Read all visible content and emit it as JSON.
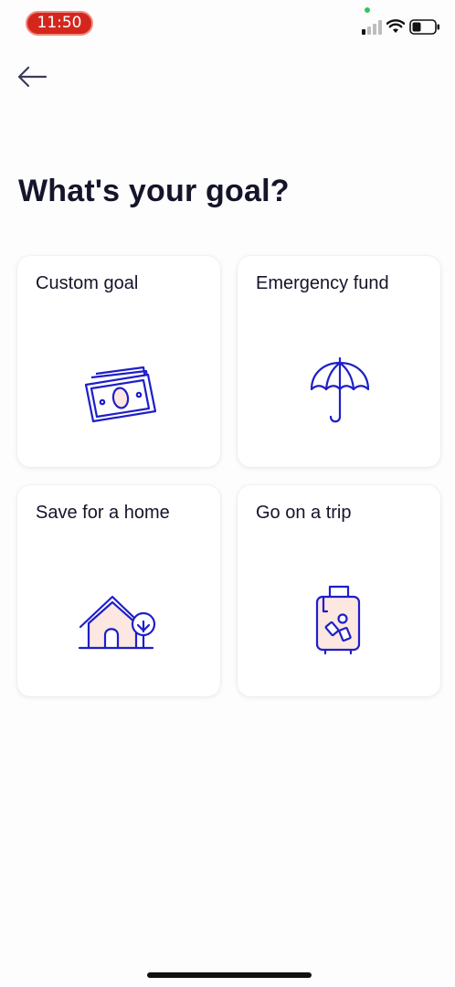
{
  "status_bar": {
    "time": "11:50"
  },
  "header": {
    "title": "What's your goal?"
  },
  "goals": [
    {
      "label": "Custom goal",
      "icon": "money-icon"
    },
    {
      "label": "Emergency fund",
      "icon": "umbrella-icon"
    },
    {
      "label": "Save for a home",
      "icon": "house-icon"
    },
    {
      "label": "Go on a trip",
      "icon": "suitcase-icon"
    }
  ],
  "colors": {
    "icon_stroke": "#1f1fc8",
    "icon_fill_accent": "#fde7e1",
    "title_text": "#14142b",
    "time_pill": "#d3271e"
  }
}
